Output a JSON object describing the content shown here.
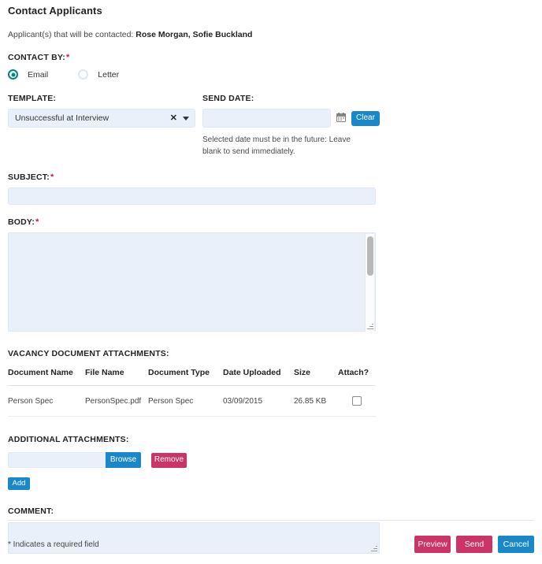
{
  "header": {
    "title": "Contact Applicants",
    "applicants_prefix": "Applicant(s) that will be contacted: ",
    "applicants_names": "Rose Morgan, Sofie Buckland"
  },
  "contact_by": {
    "label": "CONTACT BY:",
    "required_mark": "*",
    "options": [
      {
        "label": "Email",
        "selected": true
      },
      {
        "label": "Letter",
        "selected": false
      }
    ]
  },
  "template": {
    "label": "TEMPLATE:",
    "value": "Unsuccessful at Interview",
    "clear_glyph": "✕",
    "options": [
      "Unsuccessful at Interview"
    ]
  },
  "send_date": {
    "label": "SEND DATE:",
    "value": "",
    "placeholder": "",
    "clear_label": "Clear",
    "hint": "Selected date must be in the future: Leave blank to send immediately."
  },
  "subject": {
    "label": "SUBJECT:",
    "required_mark": "*",
    "value": "",
    "placeholder": ""
  },
  "body": {
    "label": "BODY:",
    "required_mark": "*",
    "value": "",
    "placeholder": ""
  },
  "vacancy_documents": {
    "label": "VACANCY DOCUMENT ATTACHMENTS:",
    "columns": [
      "Document Name",
      "File Name",
      "Document Type",
      "Date Uploaded",
      "Size",
      "Attach?"
    ],
    "rows": [
      {
        "document_name": "Person Spec",
        "file_name": "PersonSpec.pdf",
        "document_type": "Person Spec",
        "date_uploaded": "03/09/2015",
        "size": "26.85 KB",
        "attached": false
      }
    ]
  },
  "additional_attachments": {
    "label": "ADDITIONAL ATTACHMENTS:",
    "file_value": "",
    "browse_label": "Browse",
    "remove_label": "Remove",
    "add_label": "Add"
  },
  "comment": {
    "label": "COMMENT:",
    "value": "",
    "placeholder": ""
  },
  "footer": {
    "required_note": "* Indicates a required field",
    "preview_label": "Preview",
    "send_label": "Send",
    "cancel_label": "Cancel"
  },
  "colors": {
    "accent_blue": "#1a87c8",
    "accent_pink": "#cc3366",
    "radio_teal": "#00857a",
    "required_red": "#c2185b",
    "input_fill": "#eaf0f9"
  }
}
